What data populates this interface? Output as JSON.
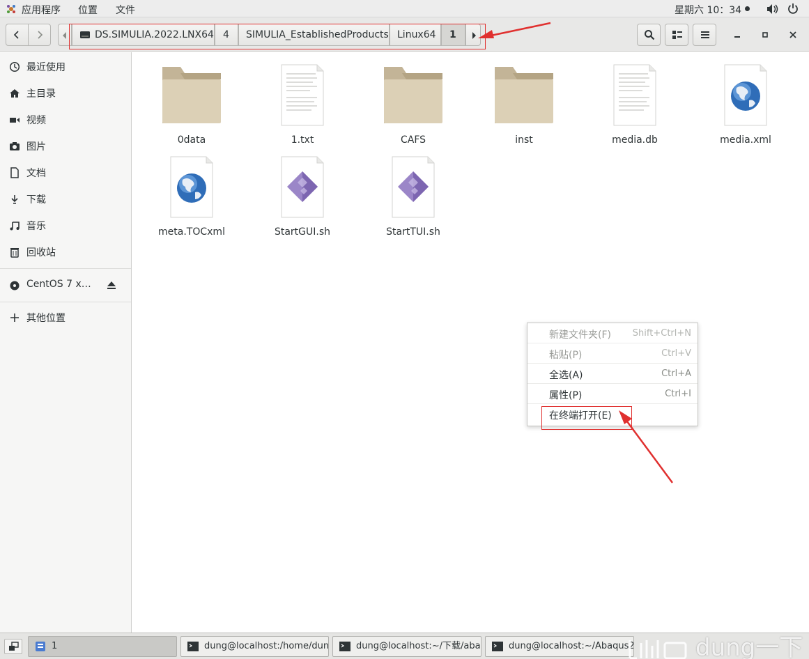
{
  "topbar": {
    "menus": [
      "应用程序",
      "位置",
      "文件"
    ],
    "clock": "星期六 10：34"
  },
  "pathbar": {
    "crumbs": [
      {
        "label": "DS.SIMULIA.2022.LNX64",
        "has_drive_icon": true
      },
      {
        "label": "4"
      },
      {
        "label": "SIMULIA_EstablishedProducts"
      },
      {
        "label": "Linux64"
      },
      {
        "label": "1",
        "active": true
      }
    ]
  },
  "sidebar": {
    "items": [
      {
        "label": "最近使用",
        "icon": "clock-icon"
      },
      {
        "label": "主目录",
        "icon": "home-icon"
      },
      {
        "label": "视频",
        "icon": "video-icon"
      },
      {
        "label": "图片",
        "icon": "camera-icon"
      },
      {
        "label": "文档",
        "icon": "document-icon"
      },
      {
        "label": "下载",
        "icon": "download-icon"
      },
      {
        "label": "音乐",
        "icon": "music-icon"
      },
      {
        "label": "回收站",
        "icon": "trash-icon"
      }
    ],
    "devices": [
      {
        "label": "CentOS 7 x…",
        "icon": "disc-icon"
      }
    ],
    "other": {
      "label": "其他位置",
      "icon": "plus-icon"
    }
  },
  "files": [
    {
      "name": "0data",
      "type": "folder"
    },
    {
      "name": "1.txt",
      "type": "text"
    },
    {
      "name": "CAFS",
      "type": "folder"
    },
    {
      "name": "inst",
      "type": "folder"
    },
    {
      "name": "media.db",
      "type": "text"
    },
    {
      "name": "media.xml",
      "type": "web"
    },
    {
      "name": "meta.TOCxml",
      "type": "web"
    },
    {
      "name": "StartGUI.sh",
      "type": "script"
    },
    {
      "name": "StartTUI.sh",
      "type": "script"
    }
  ],
  "context_menu": {
    "items": [
      {
        "label": "新建文件夹(F)",
        "shortcut": "Shift+Ctrl+N",
        "enabled": false
      },
      {
        "label": "粘贴(P)",
        "shortcut": "Ctrl+V",
        "enabled": false
      },
      {
        "label": "全选(A)",
        "shortcut": "Ctrl+A",
        "enabled": true
      },
      {
        "label": "属性(P)",
        "shortcut": "Ctrl+I",
        "enabled": true
      },
      {
        "label": "在终端打开(E)",
        "shortcut": "",
        "enabled": true
      }
    ]
  },
  "taskbar": {
    "tasks": [
      {
        "label": "1",
        "icon": "file-manager-icon",
        "active": true
      },
      {
        "label": "dung@localhost:/home/dun…",
        "icon": "terminal-icon"
      },
      {
        "label": "dung@localhost:~/下载/aba…",
        "icon": "terminal-icon"
      },
      {
        "label": "dung@localhost:~/Abaqus2…",
        "icon": "terminal-icon"
      }
    ],
    "watermark": "dung一下"
  },
  "colors": {
    "annotation_red": "#e0302f",
    "folder_tan": "#d9ccb1"
  }
}
